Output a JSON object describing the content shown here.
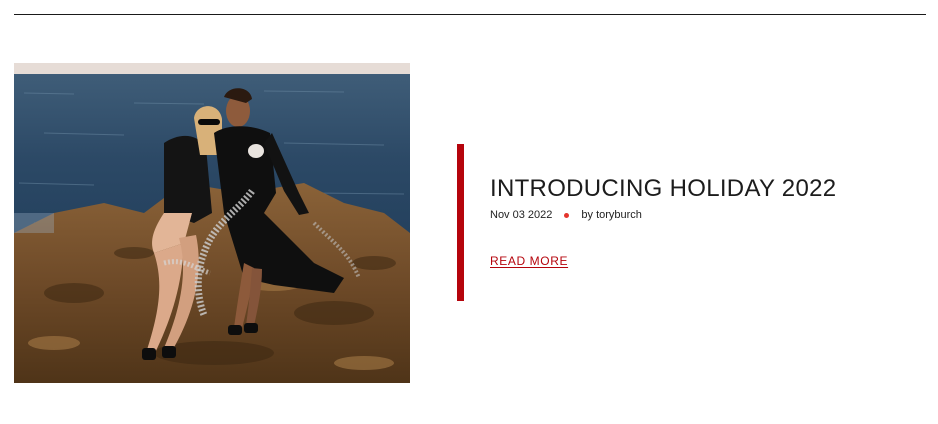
{
  "colors": {
    "accent": "#b5040c",
    "dot": "#e4352d",
    "text": "#1c1c1c",
    "rule": "#1a1a1a"
  },
  "post": {
    "image_alt": "photo-two-women-seated-on-seaside-rocks",
    "title": "INTRODUCING HOLIDAY 2022",
    "date": "Nov 03 2022",
    "author": "by toryburch",
    "read_more": "READ MORE"
  }
}
